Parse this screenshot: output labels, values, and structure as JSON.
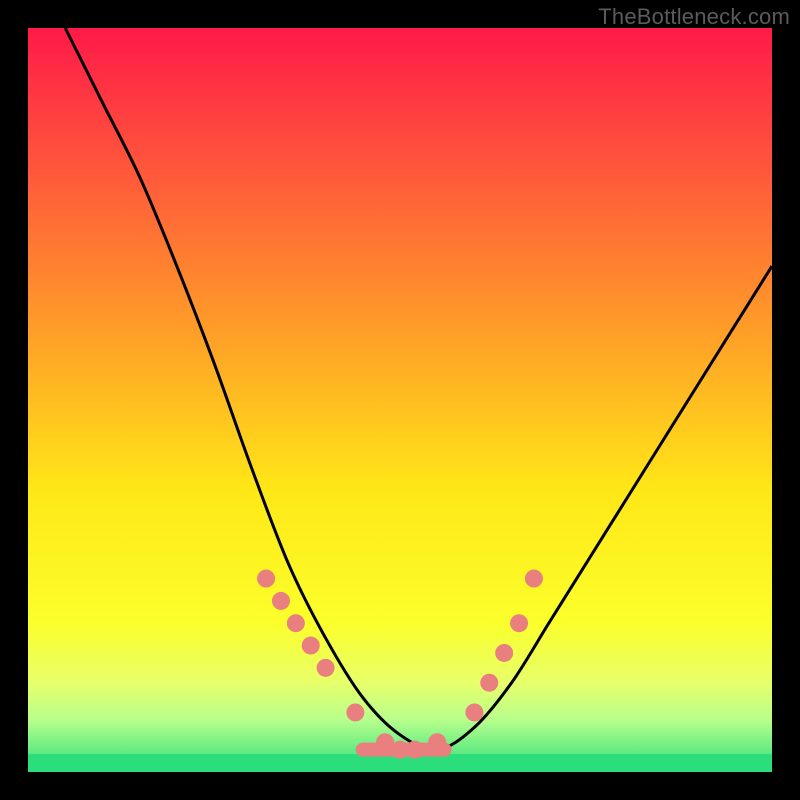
{
  "watermark": "TheBottleneck.com",
  "colors": {
    "accent_dot": "#e97f7f",
    "curve": "#000000",
    "bottom_band": "#2cde7b"
  },
  "chart_data": {
    "type": "line",
    "title": "",
    "xlabel": "",
    "ylabel": "",
    "xlim": [
      0,
      100
    ],
    "ylim": [
      0,
      100
    ],
    "series": [
      {
        "name": "bottleneck-curve",
        "x": [
          5,
          10,
          15,
          20,
          25,
          30,
          35,
          40,
          45,
          50,
          55,
          60,
          65,
          70,
          75,
          80,
          85,
          90,
          95,
          100
        ],
        "y": [
          100,
          90,
          80,
          68,
          55,
          41,
          28,
          18,
          10,
          5,
          3,
          6,
          12,
          20,
          28,
          36,
          44,
          52,
          60,
          68
        ]
      }
    ],
    "highlight_points": {
      "name": "marked-points",
      "x": [
        32,
        34,
        36,
        38,
        40,
        44,
        48,
        50,
        52,
        55,
        60,
        62,
        64,
        66,
        68
      ],
      "y": [
        26,
        23,
        20,
        17,
        14,
        8,
        4,
        3,
        3,
        4,
        8,
        12,
        16,
        20,
        26
      ]
    },
    "gradient_stops": [
      {
        "offset": 0.0,
        "color": "#ff1a49"
      },
      {
        "offset": 0.2,
        "color": "#ff5a3a"
      },
      {
        "offset": 0.42,
        "color": "#ffa227"
      },
      {
        "offset": 0.62,
        "color": "#ffe717"
      },
      {
        "offset": 0.8,
        "color": "#fbff2b"
      },
      {
        "offset": 0.88,
        "color": "#e7ff6a"
      },
      {
        "offset": 0.93,
        "color": "#b7ff8c"
      },
      {
        "offset": 1.0,
        "color": "#2cde7b"
      }
    ]
  }
}
